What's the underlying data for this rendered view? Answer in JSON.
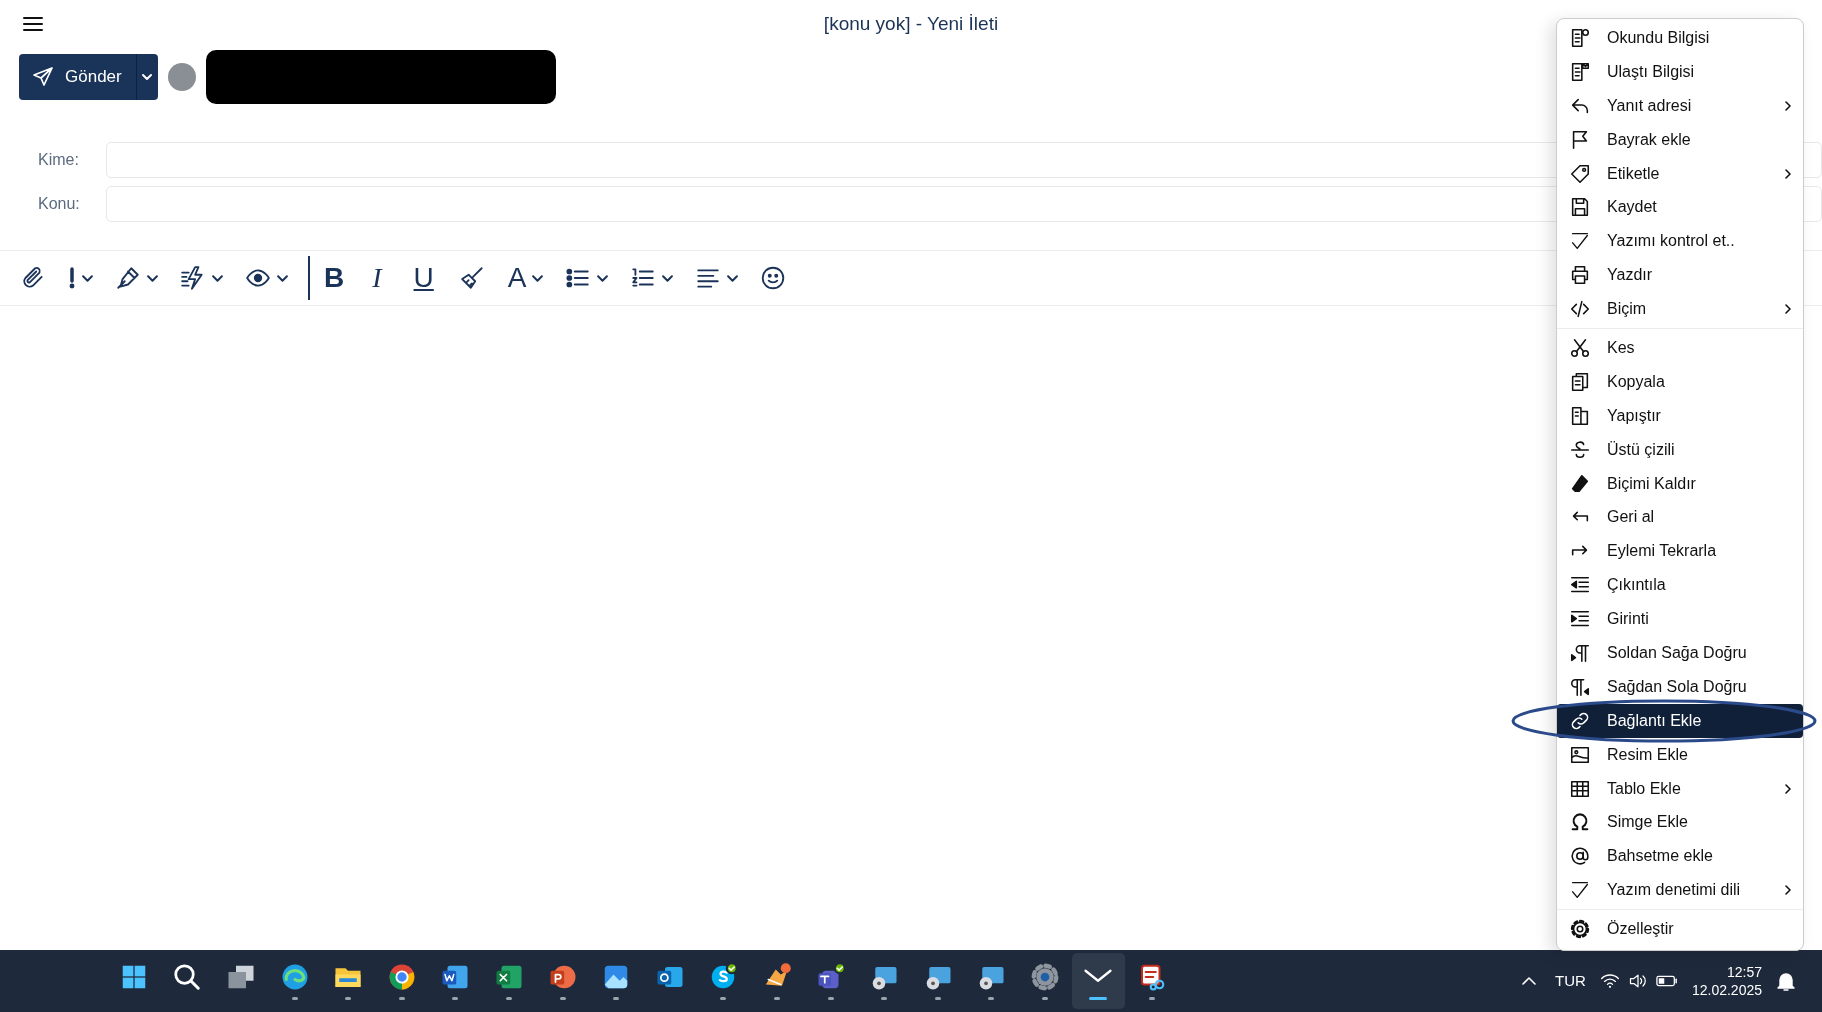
{
  "window": {
    "title": "[konu yok] - Yeni İleti"
  },
  "send_button": {
    "label": "Gönder"
  },
  "fields": [
    {
      "label": "Kime:"
    },
    {
      "label": "Konu:"
    }
  ],
  "toolbar": {
    "bold": "B",
    "italic": "I",
    "underline": "U",
    "font_color": "A"
  },
  "context_menu": {
    "sections": [
      [
        {
          "label": "Okundu Bilgisi",
          "submenu": false,
          "selected": false
        },
        {
          "label": "Ulaştı Bilgisi",
          "submenu": false,
          "selected": false
        },
        {
          "label": "Yanıt adresi",
          "submenu": true,
          "selected": false
        },
        {
          "label": "Bayrak ekle",
          "submenu": false,
          "selected": false
        },
        {
          "label": "Etiketle",
          "submenu": true,
          "selected": false
        },
        {
          "label": "Kaydet",
          "submenu": false,
          "selected": false
        },
        {
          "label": "Yazımı kontrol et..",
          "submenu": false,
          "selected": false
        },
        {
          "label": "Yazdır",
          "submenu": false,
          "selected": false
        },
        {
          "label": "Biçim",
          "submenu": true,
          "selected": false
        }
      ],
      [
        {
          "label": "Kes",
          "submenu": false,
          "selected": false
        },
        {
          "label": "Kopyala",
          "submenu": false,
          "selected": false
        },
        {
          "label": "Yapıştır",
          "submenu": false,
          "selected": false
        },
        {
          "label": "Üstü çizili",
          "submenu": false,
          "selected": false
        },
        {
          "label": "Biçimi Kaldır",
          "submenu": false,
          "selected": false
        },
        {
          "label": "Geri al",
          "submenu": false,
          "selected": false
        },
        {
          "label": "Eylemi Tekrarla",
          "submenu": false,
          "selected": false
        },
        {
          "label": "Çıkıntıla",
          "submenu": false,
          "selected": false
        },
        {
          "label": "Girinti",
          "submenu": false,
          "selected": false
        },
        {
          "label": "Soldan Sağa Doğru",
          "submenu": false,
          "selected": false
        },
        {
          "label": "Sağdan Sola Doğru",
          "submenu": false,
          "selected": false
        },
        {
          "label": "Bağlantı Ekle",
          "submenu": false,
          "selected": true
        },
        {
          "label": "Resim Ekle",
          "submenu": false,
          "selected": false
        },
        {
          "label": "Tablo Ekle",
          "submenu": true,
          "selected": false
        },
        {
          "label": "Simge Ekle",
          "submenu": false,
          "selected": false
        },
        {
          "label": "Bahsetme ekle",
          "submenu": false,
          "selected": false
        },
        {
          "label": "Yazım denetimi dili",
          "submenu": true,
          "selected": false
        }
      ],
      [
        {
          "label": "Özelleştir",
          "submenu": false,
          "selected": false
        }
      ]
    ]
  },
  "taskbar": {
    "apps": [
      {
        "running": false,
        "selected": false
      },
      {
        "running": false,
        "selected": false
      },
      {
        "running": false,
        "selected": false
      },
      {
        "running": true,
        "selected": false
      },
      {
        "running": true,
        "selected": false
      },
      {
        "running": true,
        "selected": false
      },
      {
        "running": true,
        "selected": false
      },
      {
        "running": true,
        "selected": false
      },
      {
        "running": true,
        "selected": false
      },
      {
        "running": true,
        "selected": false
      },
      {
        "running": false,
        "selected": false
      },
      {
        "running": true,
        "selected": false
      },
      {
        "running": true,
        "selected": false
      },
      {
        "running": true,
        "selected": false
      },
      {
        "running": true,
        "selected": false
      },
      {
        "running": true,
        "selected": false
      },
      {
        "running": true,
        "selected": false
      },
      {
        "running": true,
        "selected": false
      },
      {
        "running": true,
        "selected": true
      },
      {
        "running": true,
        "selected": false
      }
    ],
    "language": "TUR",
    "time": "12:57",
    "date": "12.02.2025"
  }
}
